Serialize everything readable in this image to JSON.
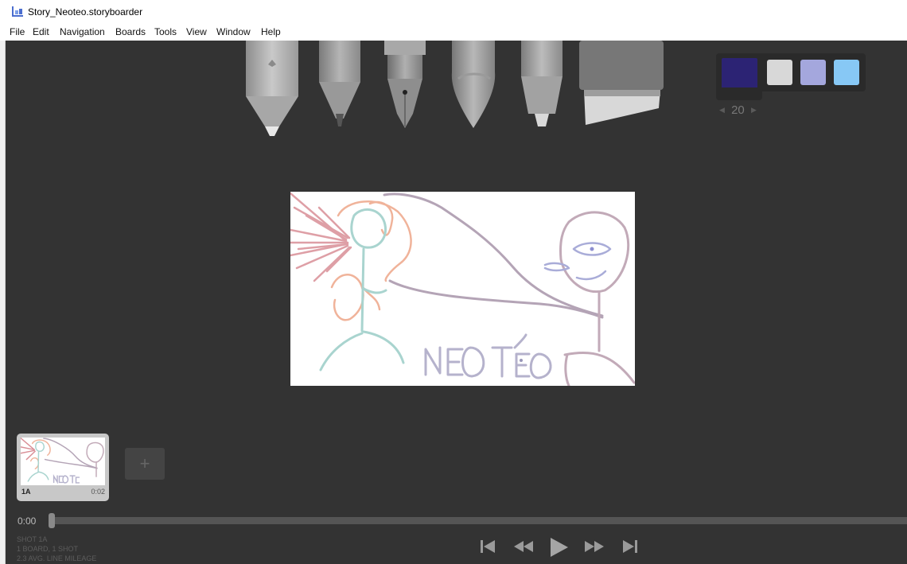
{
  "window": {
    "title": "Story_Neoteo.storyboarder"
  },
  "menu": [
    "File",
    "Edit",
    "Navigation",
    "Boards",
    "Tools",
    "View",
    "Window",
    "Help"
  ],
  "tools": [
    {
      "name": "light-pencil-icon"
    },
    {
      "name": "pencil-icon"
    },
    {
      "name": "pen-icon"
    },
    {
      "name": "brush-icon"
    },
    {
      "name": "note-pen-icon"
    },
    {
      "name": "eraser-icon"
    }
  ],
  "palette": {
    "colors": [
      "#2c2374",
      "#d8d8d8",
      "#a4a7dd",
      "#87c8f5"
    ],
    "brush_size": "20"
  },
  "board": {
    "drawing_text": "NEOTEO",
    "thumbnail": {
      "label": "1A",
      "duration": "0:02"
    }
  },
  "timeline": {
    "timecode": "0:00",
    "position": 0
  },
  "stats": {
    "line1": "SHOT 1A",
    "line2": "1 BOARD, 1 SHOT",
    "line3": "2.3 AVG. LINE MILEAGE"
  },
  "transport": [
    "skip-to-start-icon",
    "rewind-icon",
    "play-icon",
    "fast-forward-icon",
    "skip-to-end-icon"
  ]
}
